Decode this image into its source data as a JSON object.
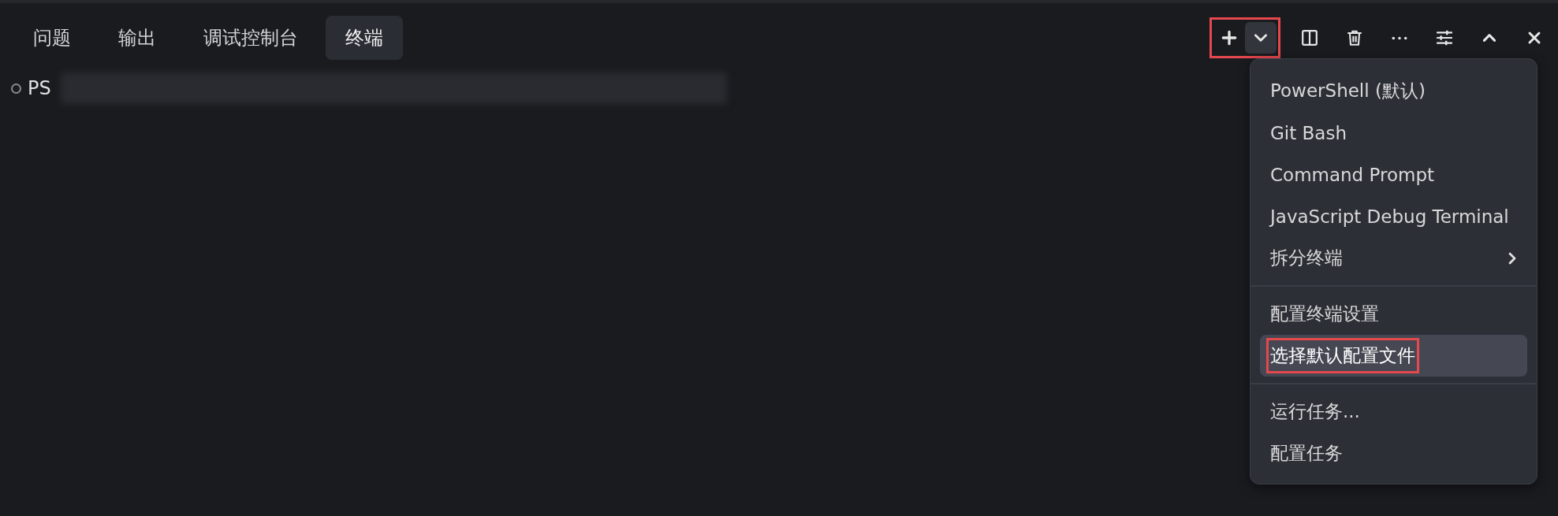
{
  "tabs": [
    {
      "label": "问题",
      "selected": false
    },
    {
      "label": "输出",
      "selected": false
    },
    {
      "label": "调试控制台",
      "selected": false
    },
    {
      "label": "终端",
      "selected": true
    }
  ],
  "toolbar": {
    "new_terminal_annotated": true,
    "dropdown_open": true
  },
  "terminal": {
    "prompt": "PS",
    "path_blurred": true
  },
  "menu": {
    "items": [
      {
        "kind": "item",
        "label": "PowerShell (默认)",
        "selected": false,
        "annotated": false
      },
      {
        "kind": "item",
        "label": "Git Bash",
        "selected": false,
        "annotated": false
      },
      {
        "kind": "item",
        "label": "Command Prompt",
        "selected": false,
        "annotated": false
      },
      {
        "kind": "item",
        "label": "JavaScript Debug Terminal",
        "selected": false,
        "annotated": false
      },
      {
        "kind": "submenu",
        "label": "拆分终端",
        "selected": false,
        "annotated": false
      },
      {
        "kind": "separator"
      },
      {
        "kind": "item",
        "label": "配置终端设置",
        "selected": false,
        "annotated": false
      },
      {
        "kind": "item",
        "label": "选择默认配置文件",
        "selected": true,
        "annotated": true
      },
      {
        "kind": "separator"
      },
      {
        "kind": "item",
        "label": "运行任务...",
        "selected": false,
        "annotated": false
      },
      {
        "kind": "item",
        "label": "配置任务",
        "selected": false,
        "annotated": false
      }
    ]
  }
}
